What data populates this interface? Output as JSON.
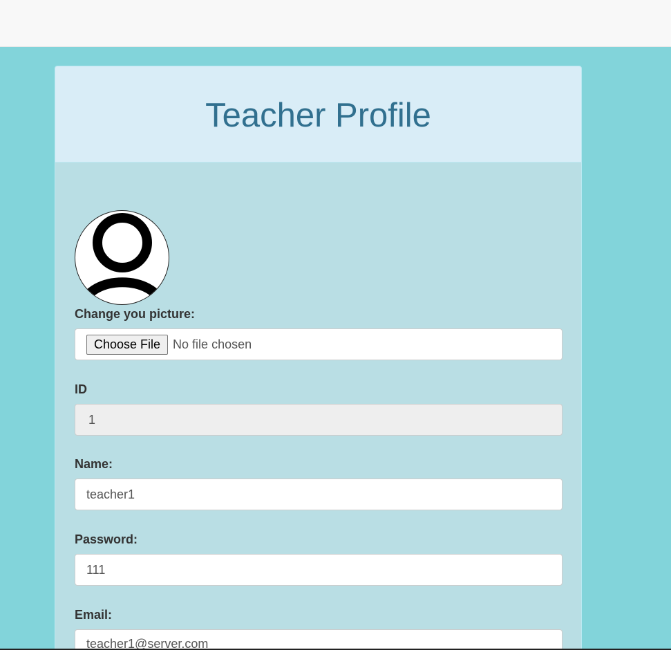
{
  "panel": {
    "title": "Teacher Profile"
  },
  "avatar": {
    "icon": "user-avatar-icon"
  },
  "picture": {
    "label": "Change you picture:",
    "button_label": "Choose File",
    "status": "No file chosen"
  },
  "fields": {
    "id": {
      "label": "ID",
      "value": "1"
    },
    "name": {
      "label": "Name:",
      "value": "teacher1"
    },
    "password": {
      "label": "Password:",
      "value": "111"
    },
    "email": {
      "label": "Email:",
      "value": "teacher1@server.com"
    }
  },
  "colors": {
    "page_background": "#82d4da",
    "panel_background": "#b9dee4",
    "heading_background": "#d9edf7",
    "title_color": "#31708f"
  }
}
